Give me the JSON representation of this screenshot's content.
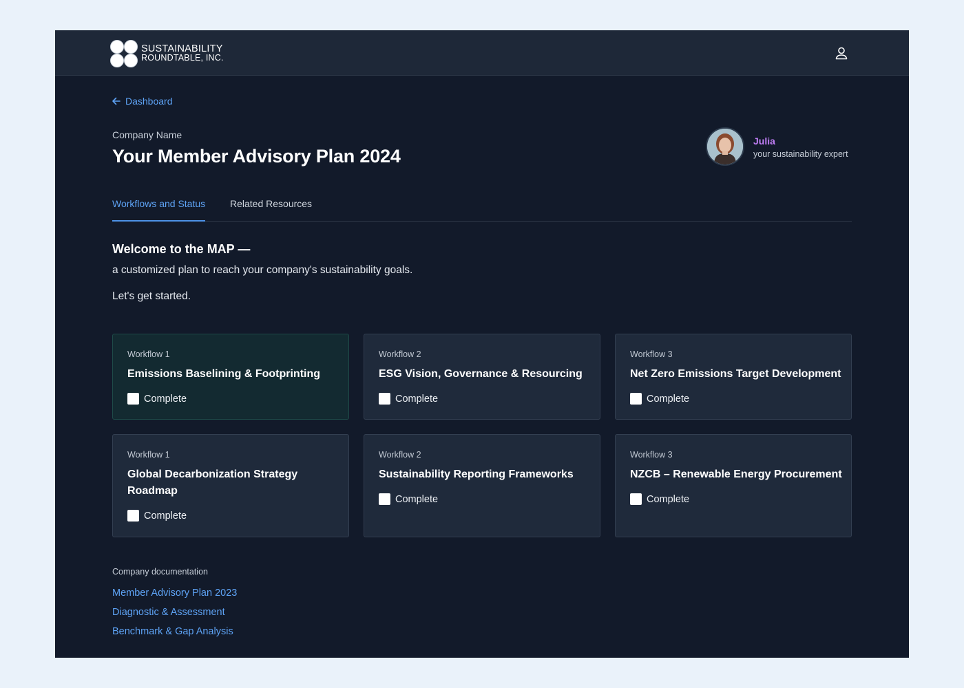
{
  "header": {
    "logo_line1": "SUSTAINABILITY",
    "logo_line2": "ROUNDTABLE, INC.",
    "user_icon": "user-icon"
  },
  "breadcrumb": {
    "back_label": "Dashboard",
    "back_icon": "arrow-left-icon"
  },
  "page": {
    "company_name": "Company Name",
    "title": "Your Member Advisory Plan 2024"
  },
  "expert": {
    "name": "Julia",
    "role": "your sustainability expert"
  },
  "tabs": [
    {
      "label": "Workflows and Status",
      "active": true
    },
    {
      "label": "Related Resources",
      "active": false
    }
  ],
  "welcome": {
    "title": "Welcome to the MAP —",
    "subtitle": "a customized plan to reach your company's sustainability goals.",
    "start": "Let's get started."
  },
  "workflows": [
    {
      "label": "Workflow 1",
      "title": "Emissions Baselining & Footprinting",
      "checkbox_label": "Complete",
      "checked": false
    },
    {
      "label": "Workflow 2",
      "title": "ESG Vision, Governance & Resourcing",
      "checkbox_label": "Complete",
      "checked": false
    },
    {
      "label": "Workflow 3",
      "title": "Net Zero Emissions Target Development",
      "checkbox_label": "Complete",
      "checked": false
    },
    {
      "label": "Workflow 1",
      "title": "Global Decarbonization Strategy Roadmap",
      "checkbox_label": "Complete",
      "checked": false
    },
    {
      "label": "Workflow 2",
      "title": "Sustainability Reporting Frameworks",
      "checkbox_label": "Complete",
      "checked": false
    },
    {
      "label": "Workflow 3",
      "title": "NZCB – Renewable Energy Procurement",
      "checkbox_label": "Complete",
      "checked": false
    }
  ],
  "docs": {
    "title": "Company documentation",
    "links": [
      "Member Advisory Plan 2023",
      "Diagnostic & Assessment",
      "Benchmark & Gap Analysis"
    ]
  },
  "colors": {
    "background": "#121a2a",
    "header": "#1e2838",
    "card": "#1f2a3b",
    "card_highlight": "#132a31",
    "link": "#5ea3f5",
    "expert_name": "#c07ef6"
  }
}
